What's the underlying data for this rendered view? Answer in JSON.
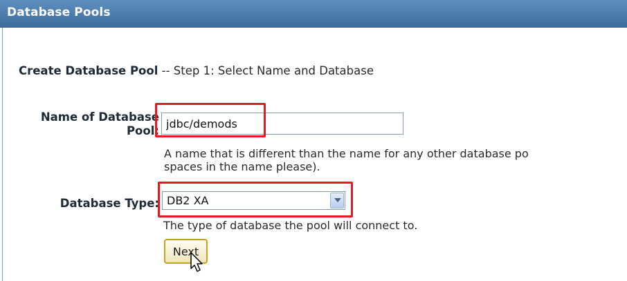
{
  "header": {
    "title": "Database Pools"
  },
  "form": {
    "step_title": "Create Database Pool",
    "step_rest": " -- Step 1: Select Name and Database",
    "name_label_line1": "Name of Database",
    "name_label_line2": "Pool:",
    "name_value": "jdbc/demods",
    "name_help_line1": "A name that is different than the name for any other database po",
    "name_help_line2": "spaces in the name please).",
    "type_label": "Database Type:",
    "type_value": "DB2 XA",
    "type_help": "The type of database the pool will connect to.",
    "next_label": "Next"
  },
  "colors": {
    "header_bg": "#4f7fae",
    "highlight": "#e11b22",
    "button_border": "#c9a21b"
  },
  "icons": {
    "dropdown": "chevron-down-icon",
    "pointer": "mouse-pointer-icon"
  }
}
